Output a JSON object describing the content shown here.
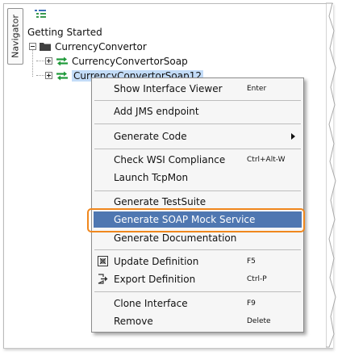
{
  "navigator": {
    "tab_label": "Navigator",
    "toolbar_icon": "tree-view-icon"
  },
  "tree": {
    "root_label": "Getting Started",
    "project": {
      "label": "CurrencyConvertor",
      "icon": "folder-icon"
    },
    "interfaces": [
      {
        "label": "CurrencyConvertorSoap",
        "icon": "soap-interface-icon",
        "selected": false
      },
      {
        "label": "CurrencyConvertorSoap12",
        "icon": "soap-interface-icon",
        "selected": true
      }
    ]
  },
  "context_menu": {
    "items": [
      {
        "label": "Show Interface Viewer",
        "shortcut": "Enter"
      },
      {
        "label": "Add JMS endpoint",
        "shortcut": ""
      },
      {
        "label": "Generate Code",
        "shortcut": "",
        "submenu": true
      },
      {
        "label": "Check WSI Compliance",
        "shortcut": "Ctrl+Alt-W"
      },
      {
        "label": "Launch TcpMon",
        "shortcut": ""
      },
      {
        "label": "Generate TestSuite",
        "shortcut": ""
      },
      {
        "label": "Generate SOAP Mock Service",
        "shortcut": "",
        "highlighted": true
      },
      {
        "label": "Generate Documentation",
        "shortcut": ""
      },
      {
        "label": "Update Definition",
        "shortcut": "F5",
        "icon": "update-definition-icon"
      },
      {
        "label": "Export Definition",
        "shortcut": "Ctrl-P",
        "icon": "export-definition-icon"
      },
      {
        "label": "Clone Interface",
        "shortcut": "F9"
      },
      {
        "label": "Remove",
        "shortcut": "Delete"
      }
    ]
  },
  "colors": {
    "highlight": "#4f77b1",
    "focus_ring": "#f0871d",
    "selection": "#c3dcf8",
    "interface_icon": "#1f9a3a"
  }
}
